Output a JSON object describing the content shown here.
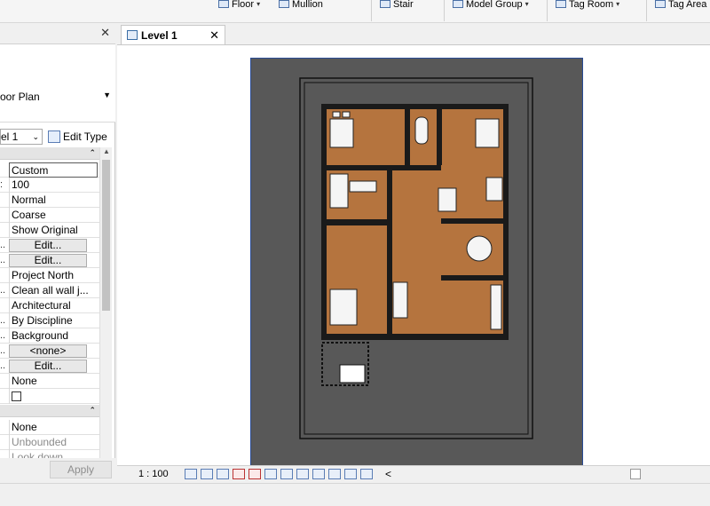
{
  "ribbon": {
    "items": [
      {
        "label": "Floor"
      },
      {
        "label": "Mullion"
      },
      {
        "label": "Stair"
      },
      {
        "label": "Model Group"
      },
      {
        "label": "Tag Room"
      },
      {
        "label": "Tag Area"
      }
    ]
  },
  "properties": {
    "type_name": "oor Plan",
    "instance_filter": "el 1",
    "edit_type_label": "Edit Type",
    "rows": [
      {
        "value": "Custom"
      },
      {
        "label": ":",
        "value": "100"
      },
      {
        "value": "Normal"
      },
      {
        "value": "Coarse"
      },
      {
        "value": "Show Original"
      },
      {
        "label": "..",
        "value": "Edit..."
      },
      {
        "label": "..",
        "value": "Edit..."
      },
      {
        "value": "Project North"
      },
      {
        "label": "..",
        "value": "Clean all wall j..."
      },
      {
        "value": "Architectural"
      },
      {
        "label": "..",
        "value": "By Discipline"
      },
      {
        "label": "..",
        "value": "Background"
      },
      {
        "label": "..",
        "value": "<none>"
      },
      {
        "label": "..",
        "value": "Edit..."
      },
      {
        "value": "None"
      },
      {
        "value": ""
      },
      {
        "value": "None"
      },
      {
        "value": "Unbounded"
      },
      {
        "value": "Look down"
      }
    ],
    "apply_label": "Apply"
  },
  "view": {
    "tab_label": "Level 1",
    "scale": "1 : 100"
  }
}
